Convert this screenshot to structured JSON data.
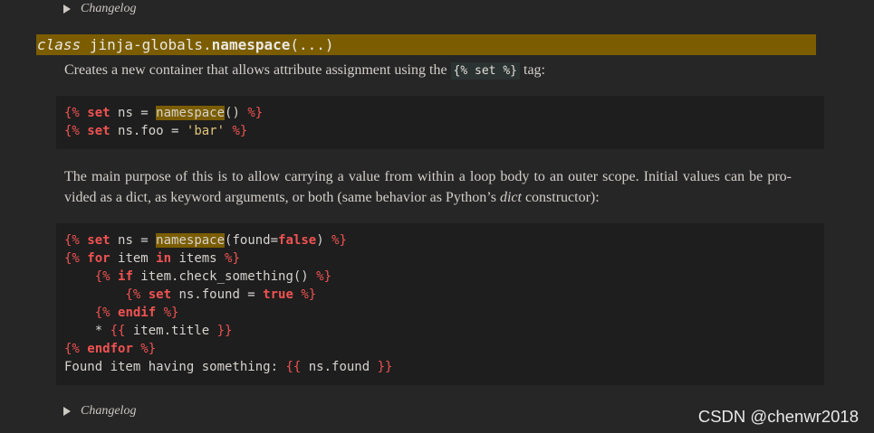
{
  "colors": {
    "page_background": "#262626",
    "code_background": "#1e1e1e",
    "highlight_background": "#7b5d00",
    "jinja_tag": "#f05252",
    "string_literal": "#e2c47c",
    "inline_code_background": "#2b3332"
  },
  "changelog_top": {
    "icon": "disclosure-triangle-icon",
    "label": "Changelog"
  },
  "signature": {
    "keyword": "class",
    "prefix": "jinja-globals.",
    "name": "namespace",
    "params": "(...)"
  },
  "description": {
    "text_before": "Creates a new container that allows attribute assignment using the ",
    "inline_code": "{% set %}",
    "text_after": " tag:"
  },
  "code_block_1": {
    "lines": [
      [
        {
          "text": "{% ",
          "color": "#f05252"
        },
        {
          "text": "set",
          "color": "#f05252",
          "bold": true
        },
        {
          "text": " ns = "
        },
        {
          "text": "namespace",
          "highlight": true
        },
        {
          "text": "()"
        },
        {
          "text": " %}",
          "color": "#f05252"
        }
      ],
      [
        {
          "text": "{% ",
          "color": "#f05252"
        },
        {
          "text": "set",
          "color": "#f05252",
          "bold": true
        },
        {
          "text": " ns.foo = "
        },
        {
          "text": "'bar'",
          "color": "#e2c47c"
        },
        {
          "text": " %}",
          "color": "#f05252"
        }
      ]
    ]
  },
  "purpose": {
    "line_1": "The main purpose of this is to allow carrying a value from within a loop body to an outer scope. Initial values can be pro-",
    "line_2_before": "vided as a dict, as keyword arguments, or both (same behavior as Python’s ",
    "line_2_emphasis": "dict",
    "line_2_after": " constructor):"
  },
  "code_block_2": {
    "lines": [
      [
        {
          "text": "{% ",
          "color": "#f05252"
        },
        {
          "text": "set",
          "color": "#f05252",
          "bold": true
        },
        {
          "text": " ns = "
        },
        {
          "text": "namespace",
          "highlight": true
        },
        {
          "text": "(found="
        },
        {
          "text": "false",
          "color": "#f05252",
          "bold": true
        },
        {
          "text": ")"
        },
        {
          "text": " %}",
          "color": "#f05252"
        }
      ],
      [
        {
          "text": "{% ",
          "color": "#f05252"
        },
        {
          "text": "for",
          "color": "#f05252",
          "bold": true
        },
        {
          "text": " item "
        },
        {
          "text": "in",
          "color": "#f05252",
          "bold": true
        },
        {
          "text": " items"
        },
        {
          "text": " %}",
          "color": "#f05252"
        }
      ],
      [
        {
          "text": "    {% ",
          "color": "#f05252"
        },
        {
          "text": "if",
          "color": "#f05252",
          "bold": true
        },
        {
          "text": " item.check_something()"
        },
        {
          "text": " %}",
          "color": "#f05252"
        }
      ],
      [
        {
          "text": "        {% ",
          "color": "#f05252"
        },
        {
          "text": "set",
          "color": "#f05252",
          "bold": true
        },
        {
          "text": " ns.found = "
        },
        {
          "text": "true",
          "color": "#f05252",
          "bold": true
        },
        {
          "text": " %}",
          "color": "#f05252"
        }
      ],
      [
        {
          "text": "    {% ",
          "color": "#f05252"
        },
        {
          "text": "endif",
          "color": "#f05252",
          "bold": true
        },
        {
          "text": " %}",
          "color": "#f05252"
        }
      ],
      [
        {
          "text": "    * "
        },
        {
          "text": "{{",
          "color": "#f05252"
        },
        {
          "text": " item.title "
        },
        {
          "text": "}}",
          "color": "#f05252"
        }
      ],
      [
        {
          "text": "{% ",
          "color": "#f05252"
        },
        {
          "text": "endfor",
          "color": "#f05252",
          "bold": true
        },
        {
          "text": " %}",
          "color": "#f05252"
        }
      ],
      [
        {
          "text": "Found item having something: "
        },
        {
          "text": "{{",
          "color": "#f05252"
        },
        {
          "text": " ns.found "
        },
        {
          "text": "}}",
          "color": "#f05252"
        }
      ]
    ]
  },
  "changelog_bottom": {
    "icon": "disclosure-triangle-icon",
    "label": "Changelog"
  },
  "watermark": {
    "text": "CSDN @chenwr2018"
  }
}
